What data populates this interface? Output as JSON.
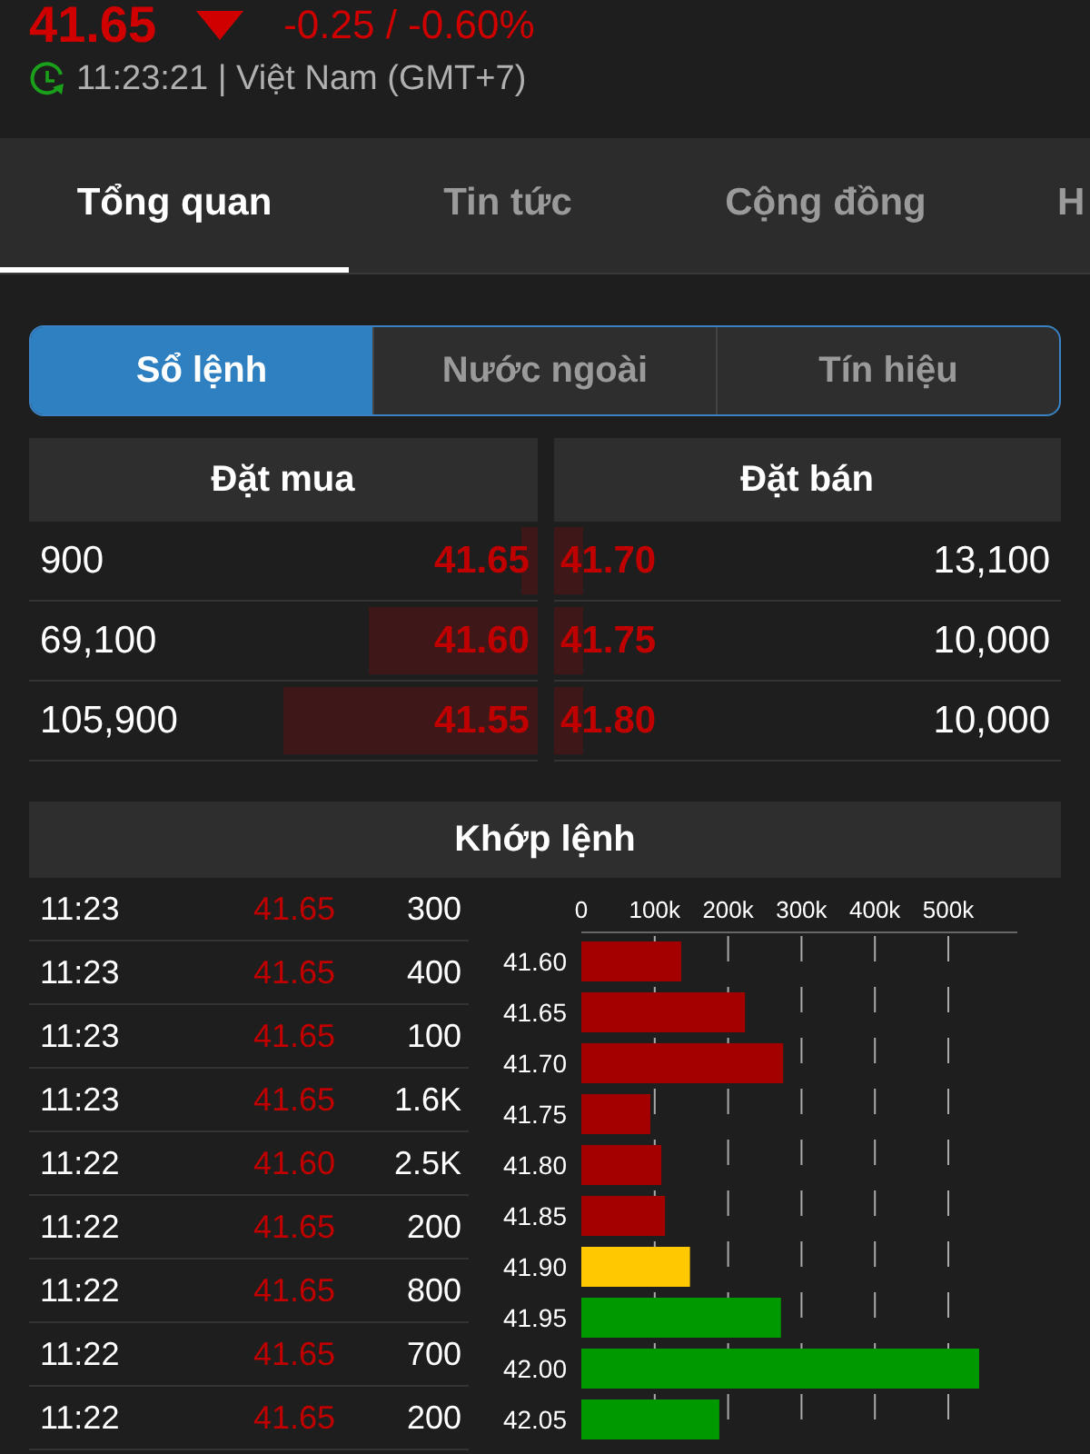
{
  "quote": {
    "price": "41.65",
    "down": true,
    "change": "-0.25 / -0.60%",
    "time": "11:23:21 | Việt Nam (GMT+7)"
  },
  "tabs": [
    {
      "label": "Tổng quan",
      "selected": true
    },
    {
      "label": "Tin tức",
      "selected": false
    },
    {
      "label": "Cộng đồng",
      "selected": false
    },
    {
      "label": "H",
      "selected": false
    }
  ],
  "segments": [
    {
      "label": "Sổ lệnh",
      "selected": true
    },
    {
      "label": "Nước ngoài",
      "selected": false
    },
    {
      "label": "Tín hiệu",
      "selected": false
    }
  ],
  "order_book": {
    "buy_header": "Đặt mua",
    "sell_header": "Đặt bán",
    "rows": [
      {
        "bid": {
          "volume": "900",
          "price": "41.65",
          "level": 0.03
        },
        "ask": {
          "price": "41.70",
          "level": 0.06,
          "volume": "13,100"
        }
      },
      {
        "bid": {
          "volume": "69,100",
          "price": "41.60",
          "level": 0.33
        },
        "ask": {
          "price": "41.75",
          "level": 0.06,
          "volume": "10,000"
        }
      },
      {
        "bid": {
          "volume": "105,900",
          "price": "41.55",
          "level": 0.5
        },
        "ask": {
          "price": "41.80",
          "level": 0.06,
          "volume": "10,000"
        }
      }
    ]
  },
  "matched": {
    "title": "Khớp lệnh",
    "trades": [
      {
        "time": "11:23",
        "price": "41.65",
        "volume": "300"
      },
      {
        "time": "11:23",
        "price": "41.65",
        "volume": "400"
      },
      {
        "time": "11:23",
        "price": "41.65",
        "volume": "100"
      },
      {
        "time": "11:23",
        "price": "41.65",
        "volume": "1.6K"
      },
      {
        "time": "11:22",
        "price": "41.60",
        "volume": "2.5K"
      },
      {
        "time": "11:22",
        "price": "41.65",
        "volume": "200"
      },
      {
        "time": "11:22",
        "price": "41.65",
        "volume": "800"
      },
      {
        "time": "11:22",
        "price": "41.65",
        "volume": "700"
      },
      {
        "time": "11:22",
        "price": "41.65",
        "volume": "200"
      }
    ],
    "chart_data": {
      "type": "bar",
      "orientation": "horizontal",
      "grid": true,
      "categories": [
        "41.60",
        "41.65",
        "41.70",
        "41.75",
        "41.80",
        "41.85",
        "41.90",
        "41.95",
        "42.00",
        "42.05"
      ],
      "xlim": [
        0,
        600000
      ],
      "xticks": [
        {
          "value": 0,
          "label": "0"
        },
        {
          "value": 100000,
          "label": "100k"
        },
        {
          "value": 200000,
          "label": "200k"
        },
        {
          "value": 300000,
          "label": "300k"
        },
        {
          "value": 400000,
          "label": "400k"
        },
        {
          "value": 500000,
          "label": "500k"
        }
      ],
      "series": [
        {
          "color": "#a50000",
          "values": [
            136000,
            223000,
            275000,
            94000,
            109000,
            114000,
            null,
            null,
            null,
            null
          ]
        },
        {
          "color": "#ffc800",
          "values": [
            null,
            null,
            null,
            null,
            null,
            null,
            148000,
            null,
            null,
            null
          ]
        },
        {
          "color": "#009a00",
          "values": [
            null,
            null,
            null,
            null,
            null,
            null,
            null,
            272000,
            542000,
            188000
          ]
        }
      ]
    }
  }
}
